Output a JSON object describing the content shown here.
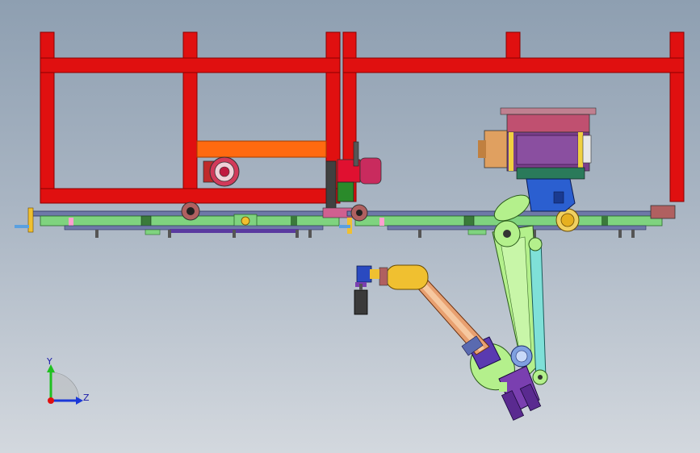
{
  "viewport": {
    "background_top": "#8e9fb1",
    "background_bottom": "#d3d8de"
  },
  "colors": {
    "frame": "#e01010",
    "beam": "#ff6a10",
    "rail": "#6e79a8",
    "rail_green": "#7fd37f",
    "arm": "#b4f08c",
    "arm_link": "#7fe0d8",
    "joint_blue": "#2b5fd0",
    "upper_arm": "#e8a070",
    "wrist_yellow": "#f0c030",
    "purple": "#7a3fb0",
    "head_box": "#c05070"
  },
  "triad": {
    "y_label": "Y",
    "z_label": "Z",
    "y_color": "#20c020",
    "z_color": "#1a38d8",
    "origin_color": "#e01010"
  }
}
